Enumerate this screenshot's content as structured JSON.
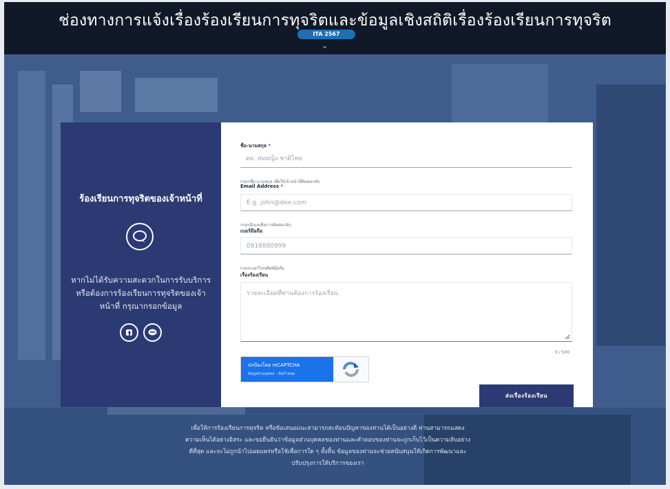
{
  "header": {
    "title": "ช่องทางการแจ้งเรื่องร้องเรียนการทุจริตและข้อมูลเชิงสถิติเรื่องร้องเรียนการทุจริต",
    "badge": "ITA 2567"
  },
  "sidebar": {
    "title": "ร้องเรียนการทุจริตของเจ้าหน้าที่",
    "description": "หากไม่ได้รับความสะดวกในการรับบริการ หรือต้องการร้องเรียนการทุจริตของเจ้าหน้าที่ กรุณากรอกข้อมูล",
    "icons": [
      "chat-icon",
      "facebook-icon",
      "line-icon"
    ]
  },
  "form": {
    "name": {
      "label": "ชื่อ-นามสกุล",
      "required_mark": "*",
      "placeholder": "ตย. สมหญิง ชาติไทย"
    },
    "email": {
      "hint": "กรอกชื่อ-นามสกุล เพื่อให้เจ้าหน้าที่ติดต่อกลับ",
      "label": "Email Address",
      "required_mark": "*",
      "placeholder": "E.g. john@doe.com"
    },
    "phone": {
      "hint": "กรอกอีเมลเพื่อการติดต่อกลับ",
      "label": "เบอร์มือถือ",
      "placeholder": "0818880999"
    },
    "subject": {
      "hint": "กรอกเบอร์โทรศัพท์มือถือ",
      "label": "เรื่องร้องเรียน",
      "placeholder": "รายละเอียดที่ท่านต้องการร้องเรียน"
    },
    "counter": "0 / 500",
    "captcha": {
      "line1": "ปกป้องโดย reCAPTCHA",
      "line2": "ข้อมูลส่วนบุคคล - ข้อกำหนด"
    },
    "submit_label": "ส่งเรื่องร้องเรียน"
  },
  "footer": {
    "note": "เพื่อให้การร้องเรียนการทุจริต หรือข้อเสนอแนะสามารถสะท้อนปัญหาของท่านได้เป็นอย่างดี ท่านสามารถแสดงความเห็นได้อย่างอิสระ และขอยืนยันว่าข้อมูลส่วนบุคคลของท่านและคำตอบของท่านจะถูกเก็บไว้เป็นความลับอย่างดีที่สุด และจะไม่ถูกนำไปเผยแพร่หรือใช้เพื่อการใด ๆ ทั้งสิ้น ข้อมูลของท่านจะช่วยสนับสนุนให้เกิดการพัฒนาและปรับปรุงการให้บริการของเรา"
  },
  "colors": {
    "header_bg": "#111827",
    "panel_dark": "#2c3a73",
    "badge": "#1f6fb5",
    "required": "#dc2626"
  }
}
